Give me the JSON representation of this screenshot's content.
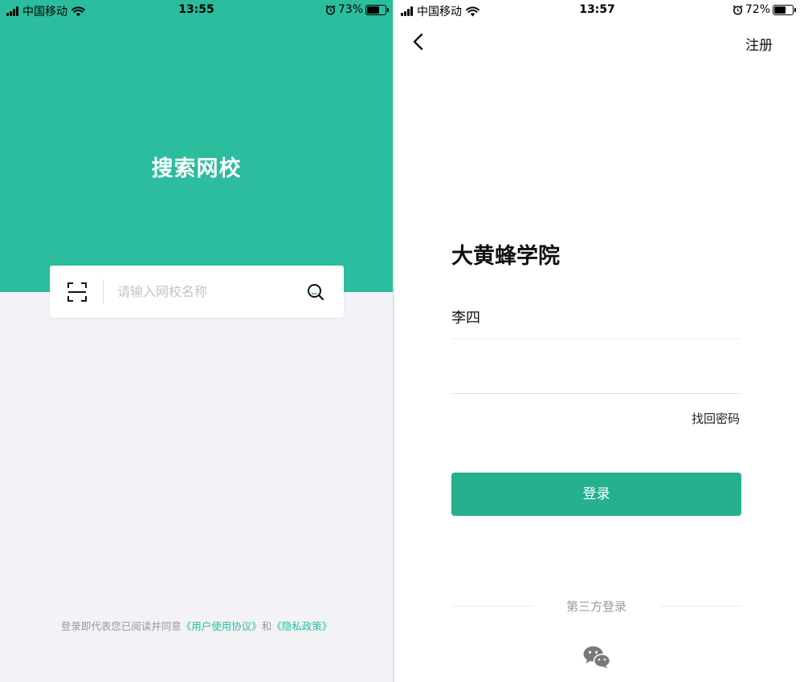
{
  "left_screen": {
    "status": {
      "carrier": "中国移动",
      "time": "13:55",
      "battery_pct": "73%",
      "battery_level": 0.73
    },
    "title": "搜索网校",
    "search": {
      "placeholder": "请输入网校名称"
    },
    "agreement": {
      "prefix": "登录即代表您已阅读并同意",
      "user_agreement": "《用户使用协议》",
      "and": "和",
      "privacy_policy": "《隐私政策》"
    }
  },
  "right_screen": {
    "status": {
      "carrier": "中国移动",
      "time": "13:57",
      "battery_pct": "72%",
      "battery_level": 0.72
    },
    "register": "注册",
    "school_name": "大黄蜂学院",
    "username": "李四",
    "forgot_password": "找回密码",
    "login": "登录",
    "third_party": "第三方登录"
  },
  "icons": {
    "scan": "scan-icon",
    "search": "search-icon",
    "back": "back-chevron-icon",
    "wechat": "wechat-icon",
    "wifi": "wifi-icon",
    "alarm": "alarm-icon"
  },
  "colors": {
    "brand": "#2bbd9d",
    "button": "#25b08f",
    "background": "#f2f2f7"
  }
}
